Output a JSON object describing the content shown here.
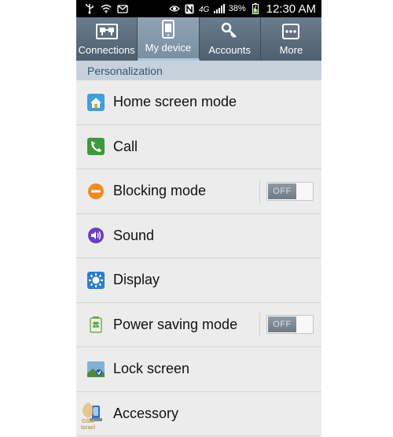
{
  "status_bar": {
    "battery_percent": "38%",
    "time": "12:30 AM",
    "icons": [
      "usb-icon",
      "wifi-icon",
      "notification-icon",
      "eye-icon",
      "nfc-icon",
      "4g-icon",
      "signal-icon",
      "battery-icon"
    ]
  },
  "tabs": [
    {
      "label": "Connections",
      "icon": "connections-icon",
      "active": false
    },
    {
      "label": "My device",
      "icon": "phone-icon",
      "active": true
    },
    {
      "label": "Accounts",
      "icon": "key-icon",
      "active": false
    },
    {
      "label": "More",
      "icon": "more-icon",
      "active": false
    }
  ],
  "section": {
    "title": "Personalization"
  },
  "items": [
    {
      "label": "Home screen mode",
      "icon": "home-icon"
    },
    {
      "label": "Call",
      "icon": "phone-call-icon"
    },
    {
      "label": "Blocking mode",
      "icon": "block-icon",
      "toggle": "OFF"
    },
    {
      "label": "Sound",
      "icon": "sound-icon"
    },
    {
      "label": "Display",
      "icon": "display-icon"
    },
    {
      "label": "Power saving mode",
      "icon": "power-saving-icon",
      "toggle": "OFF"
    },
    {
      "label": "Lock screen",
      "icon": "lock-screen-icon"
    },
    {
      "label": "Accessory",
      "icon": "accessory-icon"
    }
  ],
  "watermark": {
    "line1": "GSM",
    "line2": "Israel"
  },
  "colors": {
    "tab_bg": "#5b6c7d",
    "tab_active": "#86a0b4",
    "section_bg": "#c7d1db",
    "section_text": "#2c5876",
    "list_bg": "#ececec"
  }
}
